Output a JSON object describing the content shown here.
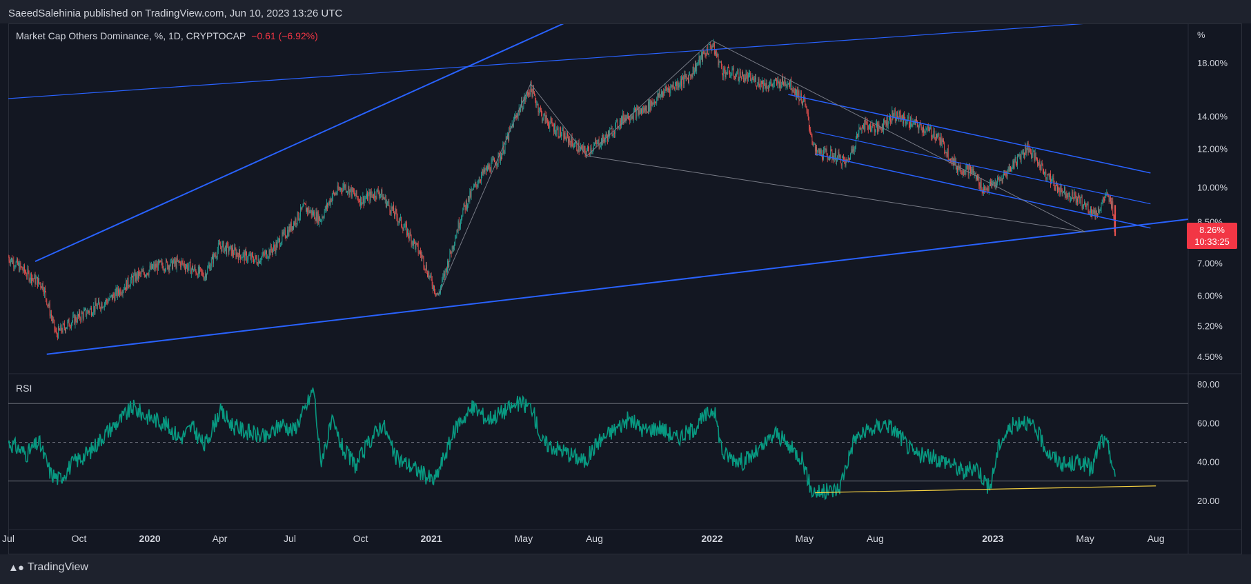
{
  "header": {
    "published": "SaeedSalehinia published on TradingView.com, Jun 10, 2023 13:26 UTC"
  },
  "legend": {
    "symbol": "Market Cap Others Dominance, %, 1D, CRYPTOCAP",
    "change": "−0.61 (−6.92%)"
  },
  "price_tag": {
    "value": "8.26%",
    "countdown": "10:33:25"
  },
  "footer": {
    "brand": "TradingView"
  },
  "colors": {
    "background": "#131722",
    "up": "#26a69a",
    "down": "#ef5350",
    "trendline": "#2962ff",
    "gray_line": "#787b86",
    "rsi": "#089981",
    "support": "#f5d142"
  },
  "chart_data": [
    {
      "type": "candlestick",
      "title": "Market Cap Others Dominance",
      "unit_label": "%",
      "y_scale": "log",
      "x_ticks": [
        {
          "label": "Jul",
          "date": "2019-07-01"
        },
        {
          "label": "Oct",
          "date": "2019-10-01"
        },
        {
          "label": "2020",
          "date": "2020-01-01"
        },
        {
          "label": "Apr",
          "date": "2020-04-01"
        },
        {
          "label": "Jul",
          "date": "2020-07-01"
        },
        {
          "label": "Oct",
          "date": "2020-10-01"
        },
        {
          "label": "2021",
          "date": "2021-01-01"
        },
        {
          "label": "May",
          "date": "2021-05-01"
        },
        {
          "label": "Aug",
          "date": "2021-08-01"
        },
        {
          "label": "2022",
          "date": "2022-01-01"
        },
        {
          "label": "May",
          "date": "2022-05-01"
        },
        {
          "label": "Aug",
          "date": "2022-08-01"
        },
        {
          "label": "2023",
          "date": "2023-01-01"
        },
        {
          "label": "May",
          "date": "2023-05-01"
        },
        {
          "label": "Aug",
          "date": "2023-08-01"
        }
      ],
      "y_ticks": [
        {
          "label": "18.00%",
          "value": 18.0
        },
        {
          "label": "14.00%",
          "value": 14.0
        },
        {
          "label": "12.00%",
          "value": 12.0
        },
        {
          "label": "10.00%",
          "value": 10.0
        },
        {
          "label": "8.50%",
          "value": 8.5
        },
        {
          "label": "7.00%",
          "value": 7.0
        },
        {
          "label": "6.00%",
          "value": 6.0
        },
        {
          "label": "5.20%",
          "value": 5.2
        },
        {
          "label": "4.50%",
          "value": 4.5
        }
      ],
      "y_range": [
        4.15,
        21.6
      ],
      "x_range": [
        "2019-07-01",
        "2023-09-12"
      ],
      "price_path": [
        [
          "2019-07-01",
          7.2
        ],
        [
          "2019-07-28",
          6.6
        ],
        [
          "2019-08-15",
          6.3
        ],
        [
          "2019-09-01",
          5.0
        ],
        [
          "2019-09-20",
          5.3
        ],
        [
          "2019-10-15",
          5.6
        ],
        [
          "2019-11-10",
          5.9
        ],
        [
          "2019-12-10",
          6.5
        ],
        [
          "2020-01-10",
          6.9
        ],
        [
          "2020-02-10",
          7.0
        ],
        [
          "2020-03-12",
          6.6
        ],
        [
          "2020-04-01",
          7.6
        ],
        [
          "2020-04-25",
          7.3
        ],
        [
          "2020-05-20",
          7.1
        ],
        [
          "2020-06-10",
          7.5
        ],
        [
          "2020-06-30",
          8.2
        ],
        [
          "2020-07-20",
          9.1
        ],
        [
          "2020-08-10",
          8.6
        ],
        [
          "2020-08-25",
          9.6
        ],
        [
          "2020-09-10",
          10.1
        ],
        [
          "2020-10-01",
          9.4
        ],
        [
          "2020-10-25",
          9.8
        ],
        [
          "2020-11-15",
          8.8
        ],
        [
          "2020-12-01",
          8.1
        ],
        [
          "2020-12-20",
          7.2
        ],
        [
          "2021-01-01",
          6.4
        ],
        [
          "2021-01-10",
          6.0
        ],
        [
          "2021-01-20",
          6.8
        ],
        [
          "2021-02-10",
          8.9
        ],
        [
          "2021-03-05",
          10.5
        ],
        [
          "2021-04-01",
          11.6
        ],
        [
          "2021-04-20",
          13.9
        ],
        [
          "2021-05-10",
          16.0
        ],
        [
          "2021-05-25",
          14.0
        ],
        [
          "2021-06-20",
          12.8
        ],
        [
          "2021-07-20",
          11.8
        ],
        [
          "2021-08-15",
          12.6
        ],
        [
          "2021-09-10",
          14.0
        ],
        [
          "2021-10-05",
          14.4
        ],
        [
          "2021-11-01",
          15.8
        ],
        [
          "2021-12-01",
          16.8
        ],
        [
          "2021-12-20",
          18.6
        ],
        [
          "2022-01-01",
          19.6
        ],
        [
          "2022-01-15",
          17.3
        ],
        [
          "2022-02-15",
          16.8
        ],
        [
          "2022-03-15",
          16.2
        ],
        [
          "2022-04-10",
          16.5
        ],
        [
          "2022-05-01",
          14.9
        ],
        [
          "2022-05-15",
          11.8
        ],
        [
          "2022-06-10",
          11.6
        ],
        [
          "2022-06-25",
          11.2
        ],
        [
          "2022-07-15",
          13.5
        ],
        [
          "2022-08-05",
          13.2
        ],
        [
          "2022-08-25",
          14.1
        ],
        [
          "2022-09-20",
          13.5
        ],
        [
          "2022-10-20",
          12.8
        ],
        [
          "2022-11-15",
          11.0
        ],
        [
          "2022-12-05",
          10.8
        ],
        [
          "2022-12-20",
          9.9
        ],
        [
          "2023-01-10",
          10.3
        ],
        [
          "2023-02-01",
          11.4
        ],
        [
          "2023-02-15",
          12.1
        ],
        [
          "2023-03-05",
          11.0
        ],
        [
          "2023-03-25",
          10.0
        ],
        [
          "2023-04-20",
          9.5
        ],
        [
          "2023-05-15",
          8.8
        ],
        [
          "2023-05-28",
          9.6
        ],
        [
          "2023-06-05",
          9.2
        ],
        [
          "2023-06-09",
          8.26
        ]
      ],
      "drawings": {
        "lines": [
          {
            "color": "trendline",
            "width": 2,
            "from": [
              "2019-08-05",
              7.05
            ],
            "to": [
              "2021-11-15",
              27.5
            ]
          },
          {
            "color": "trendline",
            "width": 1.2,
            "from": [
              "2019-07-01",
              15.2
            ],
            "to": [
              "2023-09-12",
              22.4
            ]
          },
          {
            "color": "trendline",
            "width": 2,
            "from": [
              "2019-08-20",
              4.55
            ],
            "to": [
              "2023-09-12",
              8.6
            ]
          },
          {
            "color": "trendline",
            "width": 1.5,
            "from": [
              "2022-04-10",
              15.5
            ],
            "to": [
              "2023-07-25",
              10.7
            ]
          },
          {
            "color": "trendline",
            "width": 1.2,
            "from": [
              "2022-05-15",
              13.0
            ],
            "to": [
              "2023-07-25",
              9.25
            ]
          },
          {
            "color": "trendline",
            "width": 1.5,
            "from": [
              "2022-05-15",
              11.7
            ],
            "to": [
              "2023-07-25",
              8.25
            ]
          },
          {
            "color": "gray_line",
            "width": 1,
            "from": [
              "2021-01-10",
              6.0
            ],
            "to": [
              "2021-05-10",
              16.3
            ]
          },
          {
            "color": "gray_line",
            "width": 1,
            "from": [
              "2021-05-10",
              16.3
            ],
            "to": [
              "2021-07-22",
              11.6
            ]
          },
          {
            "color": "gray_line",
            "width": 1,
            "from": [
              "2021-07-22",
              11.6
            ],
            "to": [
              "2022-01-01",
              20.0
            ]
          },
          {
            "color": "gray_line",
            "width": 1,
            "from": [
              "2022-01-01",
              20.0
            ],
            "to": [
              "2023-05-01",
              8.1
            ]
          },
          {
            "color": "gray_line",
            "width": 1,
            "from": [
              "2021-07-22",
              11.6
            ],
            "to": [
              "2023-05-01",
              8.1
            ]
          }
        ]
      }
    },
    {
      "type": "line",
      "title": "RSI",
      "y_ticks": [
        {
          "label": "80.00",
          "value": 80
        },
        {
          "label": "60.00",
          "value": 60
        },
        {
          "label": "40.00",
          "value": 40
        },
        {
          "label": "20.00",
          "value": 20
        }
      ],
      "y_range": [
        5,
        85
      ],
      "bands": {
        "upper": 70,
        "middle": 50,
        "lower": 30
      },
      "series": [
        {
          "values": [
            [
              "2019-07-01",
              50
            ],
            [
              "2019-07-25",
              44
            ],
            [
              "2019-08-10",
              50
            ],
            [
              "2019-08-25",
              34
            ],
            [
              "2019-09-05",
              31
            ],
            [
              "2019-09-25",
              40
            ],
            [
              "2019-10-15",
              45
            ],
            [
              "2019-11-05",
              55
            ],
            [
              "2019-11-25",
              62
            ],
            [
              "2019-12-10",
              68
            ],
            [
              "2019-12-25",
              64
            ],
            [
              "2020-01-20",
              60
            ],
            [
              "2020-02-10",
              52
            ],
            [
              "2020-02-25",
              58
            ],
            [
              "2020-03-12",
              48
            ],
            [
              "2020-04-01",
              66
            ],
            [
              "2020-04-20",
              58
            ],
            [
              "2020-05-10",
              55
            ],
            [
              "2020-06-01",
              52
            ],
            [
              "2020-06-20",
              60
            ],
            [
              "2020-07-05",
              56
            ],
            [
              "2020-07-20",
              66
            ],
            [
              "2020-08-01",
              78
            ],
            [
              "2020-08-10",
              40
            ],
            [
              "2020-08-25",
              60
            ],
            [
              "2020-09-10",
              45
            ],
            [
              "2020-09-25",
              38
            ],
            [
              "2020-10-15",
              52
            ],
            [
              "2020-10-30",
              60
            ],
            [
              "2020-11-15",
              42
            ],
            [
              "2020-12-05",
              38
            ],
            [
              "2020-12-20",
              34
            ],
            [
              "2021-01-05",
              30
            ],
            [
              "2021-01-20",
              45
            ],
            [
              "2021-02-05",
              60
            ],
            [
              "2021-02-25",
              68
            ],
            [
              "2021-03-15",
              62
            ],
            [
              "2021-04-05",
              66
            ],
            [
              "2021-04-25",
              70
            ],
            [
              "2021-05-12",
              68
            ],
            [
              "2021-05-25",
              50
            ],
            [
              "2021-06-20",
              46
            ],
            [
              "2021-07-20",
              40
            ],
            [
              "2021-08-05",
              50
            ],
            [
              "2021-08-25",
              56
            ],
            [
              "2021-09-15",
              62
            ],
            [
              "2021-10-05",
              56
            ],
            [
              "2021-10-25",
              58
            ],
            [
              "2021-11-15",
              52
            ],
            [
              "2021-12-05",
              56
            ],
            [
              "2021-12-25",
              64
            ],
            [
              "2022-01-03",
              68
            ],
            [
              "2022-01-15",
              44
            ],
            [
              "2022-02-10",
              40
            ],
            [
              "2022-03-05",
              46
            ],
            [
              "2022-03-25",
              55
            ],
            [
              "2022-04-10",
              48
            ],
            [
              "2022-04-28",
              42
            ],
            [
              "2022-05-10",
              25
            ],
            [
              "2022-05-25",
              24
            ],
            [
              "2022-06-15",
              26
            ],
            [
              "2022-07-05",
              52
            ],
            [
              "2022-07-25",
              56
            ],
            [
              "2022-08-15",
              60
            ],
            [
              "2022-09-01",
              54
            ],
            [
              "2022-09-20",
              44
            ],
            [
              "2022-10-15",
              42
            ],
            [
              "2022-11-05",
              40
            ],
            [
              "2022-11-25",
              34
            ],
            [
              "2022-12-10",
              38
            ],
            [
              "2022-12-28",
              26
            ],
            [
              "2023-01-10",
              50
            ],
            [
              "2023-01-25",
              58
            ],
            [
              "2023-02-10",
              62
            ],
            [
              "2023-02-28",
              55
            ],
            [
              "2023-03-15",
              44
            ],
            [
              "2023-04-05",
              38
            ],
            [
              "2023-04-25",
              40
            ],
            [
              "2023-05-10",
              36
            ],
            [
              "2023-05-22",
              52
            ],
            [
              "2023-06-02",
              46
            ],
            [
              "2023-06-09",
              30
            ]
          ]
        }
      ],
      "drawings": {
        "lines": [
          {
            "color": "support",
            "width": 1.2,
            "from": [
              "2022-05-15",
              24.0
            ],
            "to": [
              "2023-08-01",
              27.5
            ]
          }
        ]
      }
    }
  ]
}
